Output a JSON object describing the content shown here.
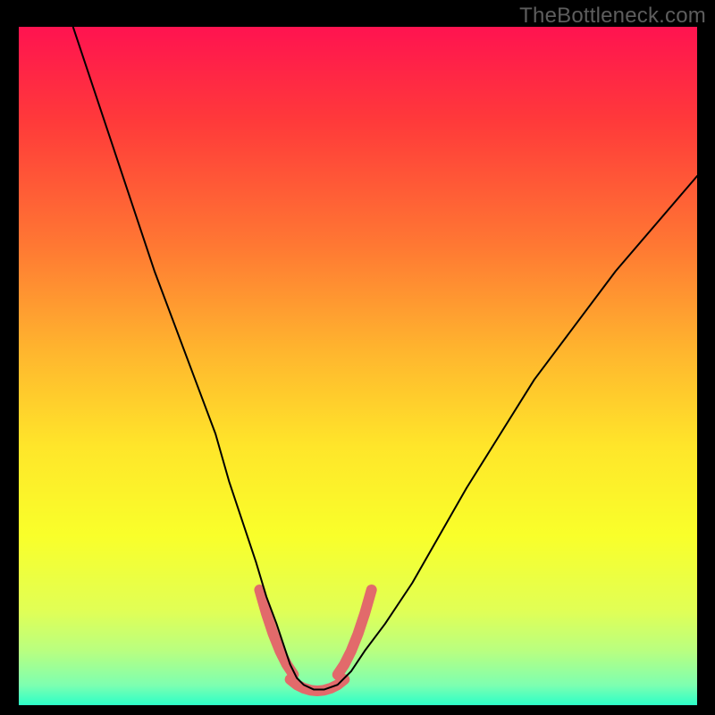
{
  "watermark": "TheBottleneck.com",
  "chart_data": {
    "type": "line",
    "title": "",
    "xlabel": "",
    "ylabel": "",
    "xlim": [
      0,
      100
    ],
    "ylim": [
      0,
      100
    ],
    "grid": false,
    "background_gradient": {
      "direction": "vertical",
      "stops": [
        {
          "offset": 0.0,
          "color": "#ff1350"
        },
        {
          "offset": 0.14,
          "color": "#ff3a3a"
        },
        {
          "offset": 0.32,
          "color": "#ff7733"
        },
        {
          "offset": 0.48,
          "color": "#ffb62e"
        },
        {
          "offset": 0.62,
          "color": "#ffe62a"
        },
        {
          "offset": 0.75,
          "color": "#f9ff2a"
        },
        {
          "offset": 0.86,
          "color": "#e1ff55"
        },
        {
          "offset": 0.92,
          "color": "#b9ff80"
        },
        {
          "offset": 0.97,
          "color": "#7effb0"
        },
        {
          "offset": 1.0,
          "color": "#2cffc8"
        }
      ]
    },
    "series": [
      {
        "name": "main-curve",
        "color": "#000000",
        "width": 2,
        "x": [
          8,
          11,
          14,
          17,
          20,
          23,
          26,
          29,
          31,
          33,
          35,
          36.5,
          38,
          39,
          40,
          41,
          42,
          43.5,
          45,
          47,
          49,
          51,
          54,
          58,
          62,
          66,
          71,
          76,
          82,
          88,
          94,
          100
        ],
        "y": [
          100,
          91,
          82,
          73,
          64,
          56,
          48,
          40,
          33,
          27,
          21,
          16,
          12,
          9,
          6,
          4,
          3,
          2.3,
          2.3,
          3,
          5,
          8,
          12,
          18,
          25,
          32,
          40,
          48,
          56,
          64,
          71,
          78
        ]
      },
      {
        "name": "tolerance-band-left",
        "color": "#e26a6b",
        "width": 12,
        "x": [
          35.5,
          36.5,
          37.5,
          38.5,
          39.5,
          40.5
        ],
        "y": [
          17,
          13.5,
          10.5,
          8,
          6,
          4.5
        ]
      },
      {
        "name": "tolerance-band-right",
        "color": "#e26a6b",
        "width": 12,
        "x": [
          47,
          48,
          49,
          50,
          51,
          52
        ],
        "y": [
          4.5,
          6,
          8,
          10.5,
          13.5,
          17
        ]
      },
      {
        "name": "tolerance-band-bottom",
        "color": "#e26a6b",
        "width": 12,
        "x": [
          40,
          41,
          42,
          43,
          44,
          45,
          46,
          47,
          48
        ],
        "y": [
          3.8,
          3.0,
          2.5,
          2.2,
          2.1,
          2.2,
          2.5,
          3.0,
          3.8
        ]
      }
    ]
  }
}
